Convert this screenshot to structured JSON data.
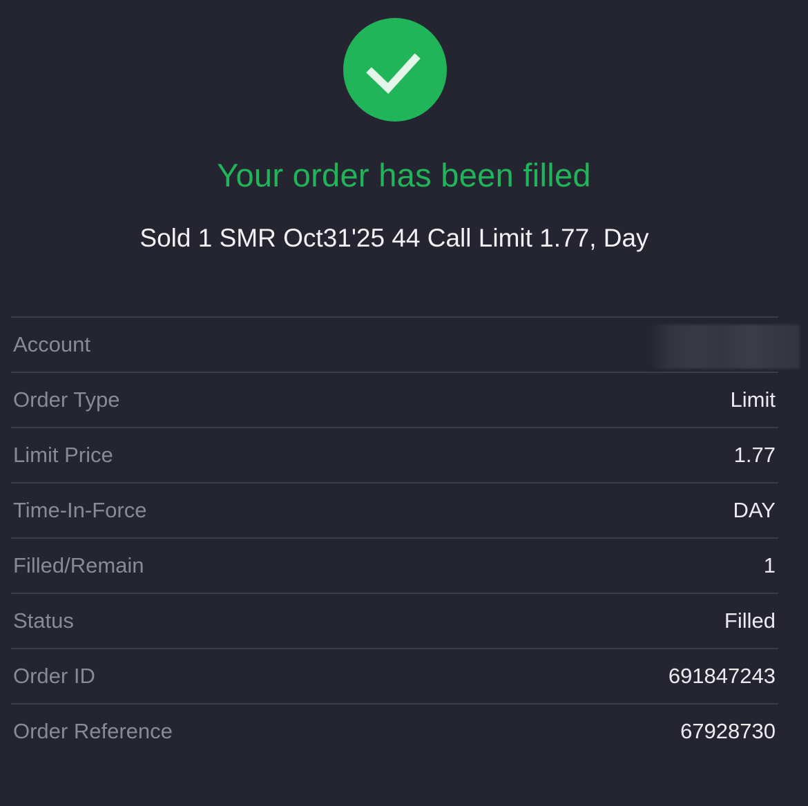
{
  "colors": {
    "accent": "#21b55a",
    "background": "#252531",
    "divider": "#3d3d49"
  },
  "status_icon": "checkmark-circle-icon",
  "headline": "Your order has been filled",
  "summary": "Sold 1 SMR Oct31'25 44 Call Limit 1.77, Day",
  "details": [
    {
      "label": "Account",
      "value": ""
    },
    {
      "label": "Order Type",
      "value": "Limit"
    },
    {
      "label": "Limit Price",
      "value": "1.77"
    },
    {
      "label": "Time-In-Force",
      "value": "DAY"
    },
    {
      "label": "Filled/Remain",
      "value": "1"
    },
    {
      "label": "Status",
      "value": "Filled"
    },
    {
      "label": "Order ID",
      "value": "691847243"
    },
    {
      "label": "Order Reference",
      "value": "67928730"
    }
  ]
}
